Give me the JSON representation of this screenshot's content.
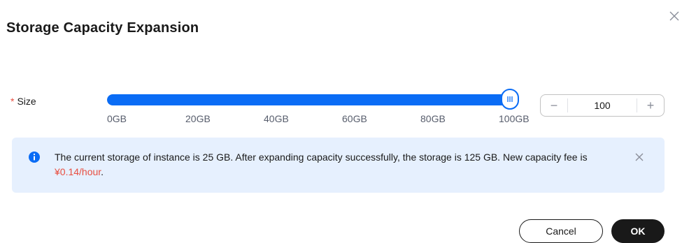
{
  "dialog": {
    "title": "Storage Capacity Expansion",
    "close_icon": "close-icon"
  },
  "size": {
    "required_mark": "*",
    "label": "Size",
    "slider": {
      "min": 0,
      "max": 100,
      "value": 100,
      "unit": "GB",
      "ticks": [
        "0GB",
        "20GB",
        "40GB",
        "60GB",
        "80GB",
        "100GB"
      ]
    },
    "stepper": {
      "minus_label": "−",
      "value": "100",
      "plus_label": "+"
    }
  },
  "alert": {
    "icon": "info-icon",
    "message_prefix": "The current storage of instance is 25 GB. After expanding capacity successfully, the storage is 125 GB. New capacity fee is ",
    "fee": "¥0.14/hour",
    "message_suffix": ".",
    "close_icon": "close-icon"
  },
  "footer": {
    "cancel_label": "Cancel",
    "ok_label": "OK"
  },
  "colors": {
    "accent": "#0a6cf5",
    "danger": "#e84e40",
    "alert_bg": "#e6f0fe",
    "primary_button": "#191919"
  }
}
